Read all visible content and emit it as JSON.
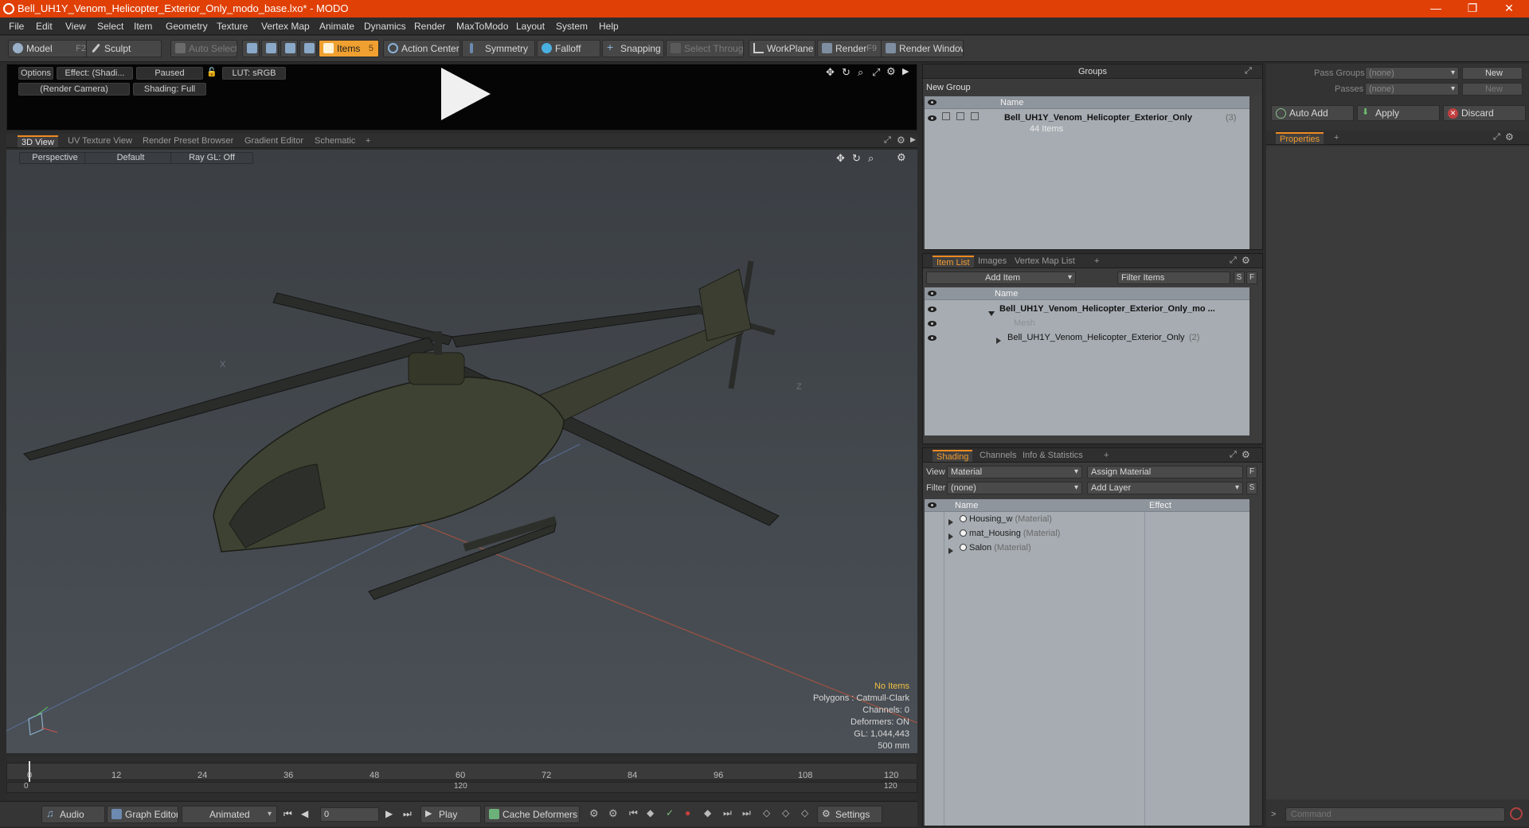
{
  "window": {
    "title": "Bell_UH1Y_Venom_Helicopter_Exterior_Only_modo_base.lxo* - MODO",
    "minimize": "—",
    "maximize": "❐",
    "close": "✕"
  },
  "menu": [
    "File",
    "Edit",
    "View",
    "Select",
    "Item",
    "Geometry",
    "Texture",
    "Vertex Map",
    "Animate",
    "Dynamics",
    "Render",
    "MaxToModo",
    "Layout",
    "System",
    "Help"
  ],
  "toolbar": {
    "model": "Model",
    "model_key": "F2",
    "sculpt": "Sculpt",
    "auto_select": "Auto Select",
    "items": "Items",
    "items_key": "5",
    "action_center": "Action Center",
    "symmetry": "Symmetry",
    "falloff": "Falloff",
    "snapping": "Snapping",
    "select_through": "Select Through",
    "workplane": "WorkPlane",
    "render": "Render",
    "render_key": "F9",
    "render_window": "Render Window"
  },
  "preview": {
    "options": "Options",
    "effect": "Effect: (Shadi...",
    "paused": "Paused",
    "lut": "LUT: sRGB",
    "camera": "(Render Camera)",
    "shading": "Shading: Full"
  },
  "viewport_tabs": [
    "3D View",
    "UV Texture View",
    "Render Preset Browser",
    "Gradient Editor",
    "Schematic",
    "+"
  ],
  "viewport": {
    "perspective": "Perspective",
    "default": "Default",
    "raygl": "Ray GL: Off",
    "axis_x_label": "X",
    "axis_z_label": "Z",
    "stats": {
      "no_items": "No Items",
      "polygons": "Polygons : Catmull-Clark",
      "channels": "Channels: 0",
      "deformers": "Deformers: ON",
      "gl": "GL: 1,044,443",
      "scale": "500 mm"
    }
  },
  "timeline": {
    "ticks": [
      "0",
      "12",
      "24",
      "36",
      "48",
      "60",
      "72",
      "84",
      "96",
      "108",
      "120"
    ],
    "range_start": "0",
    "range_mid": "120",
    "range_end": "120"
  },
  "transport": {
    "audio": "Audio",
    "graph_editor": "Graph Editor",
    "animated": "Animated",
    "frame": "0",
    "play": "Play",
    "cache_deformers": "Cache Deformers",
    "settings": "Settings"
  },
  "groups": {
    "title": "Groups",
    "new_group": "New Group",
    "col_name": "Name",
    "item_name": "Bell_UH1Y_Venom_Helicopter_Exterior_Only",
    "item_count": "(3)",
    "item_sub": "44 Items"
  },
  "item_list": {
    "tabs": [
      "Item List",
      "Images",
      "Vertex Map List",
      "+"
    ],
    "add_item": "Add Item",
    "filter_items": "Filter Items",
    "s": "S",
    "f": "F",
    "col_name": "Name",
    "rows": [
      {
        "label": "Bell_UH1Y_Venom_Helicopter_Exterior_Only_mo ..."
      },
      {
        "label": "Mesh"
      },
      {
        "label": "Bell_UH1Y_Venom_Helicopter_Exterior_Only",
        "count": "(2)"
      }
    ]
  },
  "shading": {
    "tabs": [
      "Shading",
      "Channels",
      "Info & Statistics",
      "+"
    ],
    "view_label": "View",
    "view_value": "Material",
    "assign_material": "Assign Material",
    "filter_label": "Filter",
    "filter_value": "(none)",
    "add_layer": "Add Layer",
    "f": "F",
    "s": "S",
    "col_name": "Name",
    "col_effect": "Effect",
    "rows": [
      {
        "name": "Housing_w",
        "type": "(Material)"
      },
      {
        "name": "mat_Housing",
        "type": "(Material)"
      },
      {
        "name": "Salon",
        "type": "(Material)"
      }
    ]
  },
  "pass": {
    "pass_groups_label": "Pass Groups",
    "pass_groups_value": "(none)",
    "passes_label": "Passes",
    "passes_value": "(none)",
    "new1": "New",
    "new2": "New",
    "auto_add": "Auto Add",
    "apply": "Apply",
    "discard": "Discard"
  },
  "properties": {
    "tab": "Properties",
    "plus": "+"
  },
  "command": {
    "placeholder": "Command",
    "arrow": ">"
  }
}
